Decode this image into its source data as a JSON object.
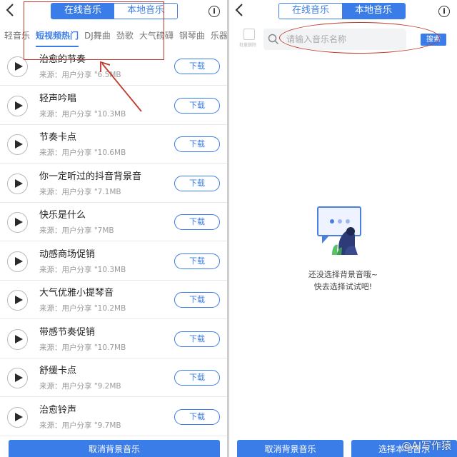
{
  "left": {
    "tabs": {
      "online": "在线音乐",
      "local": "本地音乐"
    },
    "info": "i",
    "categories": [
      "轻音乐",
      "短视频热门",
      "DJ舞曲",
      "劲歌",
      "大气磅礴",
      "钢琴曲",
      "乐器"
    ],
    "active_category": "短视频热门",
    "songs": [
      {
        "title": "治愈的节奏",
        "meta": "来源：用户分享 \"6.5MB",
        "button": "下载"
      },
      {
        "title": "轻声吟唱",
        "meta": "来源：用户分享 \"10.3MB",
        "button": "下载"
      },
      {
        "title": "节奏卡点",
        "meta": "来源：用户分享 \"10.6MB",
        "button": "下载"
      },
      {
        "title": "你一定听过的抖音背景音",
        "meta": "来源：用户分享 \"7.1MB",
        "button": "下载"
      },
      {
        "title": "快乐是什么",
        "meta": "来源：用户分享 \"7MB",
        "button": "下载"
      },
      {
        "title": "动感商场促销",
        "meta": "来源：用户分享 \"10.3MB",
        "button": "下载"
      },
      {
        "title": "大气优雅小提琴音",
        "meta": "来源：用户分享 \"10.2MB",
        "button": "下载"
      },
      {
        "title": "带感节奏促销",
        "meta": "来源：用户分享 \"10.7MB",
        "button": "下载"
      },
      {
        "title": "舒缓卡点",
        "meta": "来源：用户分享 \"9.2MB",
        "button": "下载"
      },
      {
        "title": "治愈铃声",
        "meta": "来源：用户分享 \"9.7MB",
        "button": "下载"
      }
    ],
    "bottom_button": "取消背景音乐"
  },
  "right": {
    "tabs": {
      "online": "在线音乐",
      "local": "本地音乐"
    },
    "info": "i",
    "batch_label": "批量删除",
    "search_placeholder": "请输入音乐名称",
    "search_button": "搜索",
    "empty_line1": "还没选择背景音哦~",
    "empty_line2": "快去选择试试吧!",
    "cancel_button": "取消背景音乐",
    "select_button": "选择本地音乐"
  },
  "watermark": "@AI写作猿",
  "colors": {
    "accent": "#3b7de8",
    "annotation": "#c0392b"
  }
}
